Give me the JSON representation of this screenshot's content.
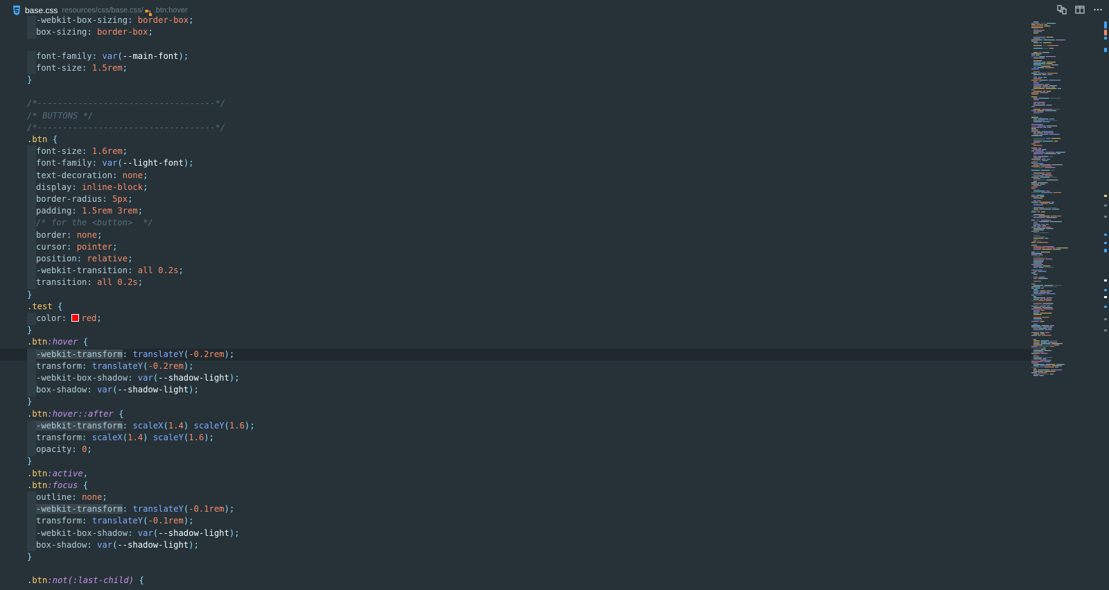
{
  "titlebar": {
    "filename": "base.css",
    "breadcrumb_path": "resources/css/base.css/",
    "breadcrumb_symbol": ".btn:hover"
  },
  "editor": {
    "lines": [
      [
        [
          "t-prop",
          "-webkit-box-sizing"
        ],
        [
          "t-punc",
          ": "
        ],
        [
          "t-num",
          "border-box"
        ],
        [
          "t-punc",
          ";"
        ]
      ],
      [
        [
          "t-prop",
          "box-sizing"
        ],
        [
          "t-punc",
          ": "
        ],
        [
          "t-num",
          "border-box"
        ],
        [
          "t-punc",
          ";"
        ]
      ],
      [],
      [
        [
          "t-prop",
          "font-family"
        ],
        [
          "t-punc",
          ": "
        ],
        [
          "t-func",
          "var"
        ],
        [
          "t-punc",
          "("
        ],
        [
          "t-var",
          "--main-font"
        ],
        [
          "t-punc",
          ");"
        ]
      ],
      [
        [
          "t-prop",
          "font-size"
        ],
        [
          "t-punc",
          ": "
        ],
        [
          "t-num",
          "1.5rem"
        ],
        [
          "t-punc",
          ";"
        ]
      ],
      [
        [
          "t-punc",
          "}"
        ]
      ],
      [],
      [
        [
          "t-comment",
          "/*-----------------------------------*/"
        ]
      ],
      [
        [
          "t-comment",
          "/* BUTTONS */"
        ]
      ],
      [
        [
          "t-comment",
          "/*-----------------------------------*/"
        ]
      ],
      [
        [
          "t-sel",
          ".btn"
        ],
        [
          "t-punc",
          " {"
        ]
      ],
      [
        [
          "t-prop",
          "font-size"
        ],
        [
          "t-punc",
          ": "
        ],
        [
          "t-num",
          "1.6rem"
        ],
        [
          "t-punc",
          ";"
        ]
      ],
      [
        [
          "t-prop",
          "font-family"
        ],
        [
          "t-punc",
          ": "
        ],
        [
          "t-func",
          "var"
        ],
        [
          "t-punc",
          "("
        ],
        [
          "t-var",
          "--light-font"
        ],
        [
          "t-punc",
          ");"
        ]
      ],
      [
        [
          "t-prop",
          "text-decoration"
        ],
        [
          "t-punc",
          ": "
        ],
        [
          "t-num",
          "none"
        ],
        [
          "t-punc",
          ";"
        ]
      ],
      [
        [
          "t-prop",
          "display"
        ],
        [
          "t-punc",
          ": "
        ],
        [
          "t-num",
          "inline-block"
        ],
        [
          "t-punc",
          ";"
        ]
      ],
      [
        [
          "t-prop",
          "border-radius"
        ],
        [
          "t-punc",
          ": "
        ],
        [
          "t-num",
          "5px"
        ],
        [
          "t-punc",
          ";"
        ]
      ],
      [
        [
          "t-prop",
          "padding"
        ],
        [
          "t-punc",
          ": "
        ],
        [
          "t-num",
          "1.5rem 3rem"
        ],
        [
          "t-punc",
          ";"
        ]
      ],
      [
        [
          "t-comment",
          "/* for the <button>  */"
        ]
      ],
      [
        [
          "t-prop",
          "border"
        ],
        [
          "t-punc",
          ": "
        ],
        [
          "t-num",
          "none"
        ],
        [
          "t-punc",
          ";"
        ]
      ],
      [
        [
          "t-prop",
          "cursor"
        ],
        [
          "t-punc",
          ": "
        ],
        [
          "t-num",
          "pointer"
        ],
        [
          "t-punc",
          ";"
        ]
      ],
      [
        [
          "t-prop",
          "position"
        ],
        [
          "t-punc",
          ": "
        ],
        [
          "t-num",
          "relative"
        ],
        [
          "t-punc",
          ";"
        ]
      ],
      [
        [
          "t-prop",
          "-webkit-transition"
        ],
        [
          "t-punc",
          ": "
        ],
        [
          "t-num",
          "all 0.2s"
        ],
        [
          "t-punc",
          ";"
        ]
      ],
      [
        [
          "t-prop",
          "transition"
        ],
        [
          "t-punc",
          ": "
        ],
        [
          "t-num",
          "all 0.2s"
        ],
        [
          "t-punc",
          ";"
        ]
      ],
      [
        [
          "t-punc",
          "}"
        ]
      ],
      [
        [
          "t-sel",
          ".test"
        ],
        [
          "t-punc",
          " {"
        ]
      ],
      [
        [
          "t-prop",
          "color"
        ],
        [
          "t-punc",
          ": "
        ],
        [
          "swatch",
          ""
        ],
        [
          "t-num",
          "red"
        ],
        [
          "t-punc",
          ";"
        ]
      ],
      [
        [
          "t-punc",
          "}"
        ]
      ],
      [
        [
          "t-sel",
          ".btn"
        ],
        [
          "t-pseudo",
          ":hover"
        ],
        [
          "t-punc",
          " {"
        ]
      ],
      [
        [
          "t-prop t-hl",
          "-webkit-transform"
        ],
        [
          "t-punc",
          ": "
        ],
        [
          "t-func",
          "translateY"
        ],
        [
          "t-punc",
          "("
        ],
        [
          "t-num",
          "-0.2rem"
        ],
        [
          "t-punc",
          ");"
        ]
      ],
      [
        [
          "t-prop",
          "transform"
        ],
        [
          "t-punc",
          ": "
        ],
        [
          "t-func",
          "translateY"
        ],
        [
          "t-punc",
          "("
        ],
        [
          "t-num",
          "-0.2rem"
        ],
        [
          "t-punc",
          ");"
        ]
      ],
      [
        [
          "t-prop",
          "-webkit-box-shadow"
        ],
        [
          "t-punc",
          ": "
        ],
        [
          "t-func",
          "var"
        ],
        [
          "t-punc",
          "("
        ],
        [
          "t-var",
          "--shadow-light"
        ],
        [
          "t-punc",
          ");"
        ]
      ],
      [
        [
          "t-prop",
          "box-shadow"
        ],
        [
          "t-punc",
          ": "
        ],
        [
          "t-func",
          "var"
        ],
        [
          "t-punc",
          "("
        ],
        [
          "t-var",
          "--shadow-light"
        ],
        [
          "t-punc",
          ");"
        ]
      ],
      [
        [
          "t-punc",
          "}"
        ]
      ],
      [
        [
          "t-sel",
          ".btn"
        ],
        [
          "t-pseudo",
          ":hover::after"
        ],
        [
          "t-punc",
          " {"
        ]
      ],
      [
        [
          "t-prop t-hl",
          "-webkit-transform"
        ],
        [
          "t-punc",
          ": "
        ],
        [
          "t-func",
          "scaleX"
        ],
        [
          "t-punc",
          "("
        ],
        [
          "t-num",
          "1.4"
        ],
        [
          "t-punc",
          ") "
        ],
        [
          "t-func",
          "scaleY"
        ],
        [
          "t-punc",
          "("
        ],
        [
          "t-num",
          "1.6"
        ],
        [
          "t-punc",
          ");"
        ]
      ],
      [
        [
          "t-prop",
          "transform"
        ],
        [
          "t-punc",
          ": "
        ],
        [
          "t-func",
          "scaleX"
        ],
        [
          "t-punc",
          "("
        ],
        [
          "t-num",
          "1.4"
        ],
        [
          "t-punc",
          ") "
        ],
        [
          "t-func",
          "scaleY"
        ],
        [
          "t-punc",
          "("
        ],
        [
          "t-num",
          "1.6"
        ],
        [
          "t-punc",
          ");"
        ]
      ],
      [
        [
          "t-prop",
          "opacity"
        ],
        [
          "t-punc",
          ": "
        ],
        [
          "t-num",
          "0"
        ],
        [
          "t-punc",
          ";"
        ]
      ],
      [
        [
          "t-punc",
          "}"
        ]
      ],
      [
        [
          "t-sel",
          ".btn"
        ],
        [
          "t-pseudo",
          ":active"
        ],
        [
          "t-punc",
          ","
        ]
      ],
      [
        [
          "t-sel",
          ".btn"
        ],
        [
          "t-pseudo",
          ":focus"
        ],
        [
          "t-punc",
          " {"
        ]
      ],
      [
        [
          "t-prop",
          "outline"
        ],
        [
          "t-punc",
          ": "
        ],
        [
          "t-num",
          "none"
        ],
        [
          "t-punc",
          ";"
        ]
      ],
      [
        [
          "t-prop t-hl",
          "-webkit-transform"
        ],
        [
          "t-punc",
          ": "
        ],
        [
          "t-func",
          "translateY"
        ],
        [
          "t-punc",
          "("
        ],
        [
          "t-num",
          "-0.1rem"
        ],
        [
          "t-punc",
          ");"
        ]
      ],
      [
        [
          "t-prop",
          "transform"
        ],
        [
          "t-punc",
          ": "
        ],
        [
          "t-func",
          "translateY"
        ],
        [
          "t-punc",
          "("
        ],
        [
          "t-num",
          "-0.1rem"
        ],
        [
          "t-punc",
          ");"
        ]
      ],
      [
        [
          "t-prop",
          "-webkit-box-shadow"
        ],
        [
          "t-punc",
          ": "
        ],
        [
          "t-func",
          "var"
        ],
        [
          "t-punc",
          "("
        ],
        [
          "t-var",
          "--shadow-light"
        ],
        [
          "t-punc",
          ");"
        ]
      ],
      [
        [
          "t-prop",
          "box-shadow"
        ],
        [
          "t-punc",
          ": "
        ],
        [
          "t-func",
          "var"
        ],
        [
          "t-punc",
          "("
        ],
        [
          "t-var",
          "--shadow-light"
        ],
        [
          "t-punc",
          ");"
        ]
      ],
      [
        [
          "t-punc",
          "}"
        ]
      ],
      [],
      [
        [
          "t-sel",
          ".btn"
        ],
        [
          "t-pseudo",
          ":not(:last-child)"
        ],
        [
          "t-punc",
          " {"
        ]
      ]
    ]
  },
  "colors": {
    "background": "#263238",
    "current_line": "#1f282d",
    "selector": "#ffcb6b",
    "pseudo": "#c792ea",
    "number": "#f78c6c",
    "function": "#82aaff",
    "comment": "#546e7a"
  },
  "icons": {
    "file": "css3-icon",
    "symbol": "symbol-class-icon",
    "actions": [
      "git-compare-icon",
      "split-editor-icon",
      "more-actions-icon"
    ]
  }
}
